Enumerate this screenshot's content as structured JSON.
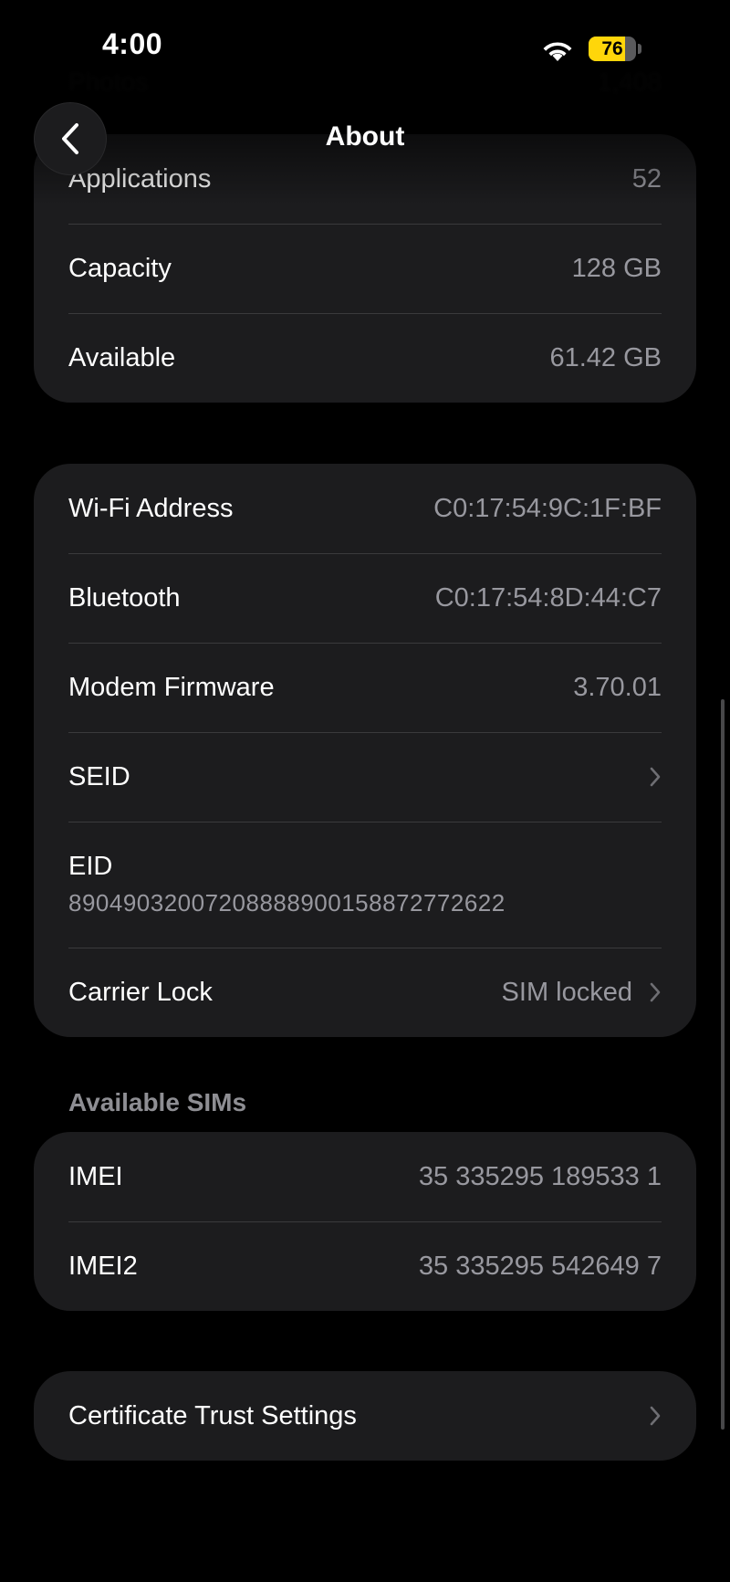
{
  "status_bar": {
    "time": "4:00",
    "battery_percent": "76",
    "battery_level": 0.76,
    "wifi_icon": "wifi-icon",
    "battery_color": "#ffd60a"
  },
  "ghost_rows": [
    {
      "label": "Photos",
      "value": "1,408"
    }
  ],
  "nav": {
    "title": "About",
    "back_icon": "chevron-left-icon"
  },
  "storage_group": [
    {
      "label": "Applications",
      "value": "52"
    },
    {
      "label": "Capacity",
      "value": "128 GB"
    },
    {
      "label": "Available",
      "value": "61.42 GB"
    }
  ],
  "network_group": {
    "wifi_address": {
      "label": "Wi-Fi Address",
      "value": "C0:17:54:9C:1F:BF"
    },
    "bluetooth": {
      "label": "Bluetooth",
      "value": "C0:17:54:8D:44:C7"
    },
    "modem_firmware": {
      "label": "Modem Firmware",
      "value": "3.70.01"
    },
    "seid": {
      "label": "SEID"
    },
    "eid": {
      "label": "EID",
      "value": "89049032007208888900158872772622"
    },
    "carrier_lock": {
      "label": "Carrier Lock",
      "value": "SIM locked"
    }
  },
  "sims_section": {
    "header": "Available SIMs",
    "imei": {
      "label": "IMEI",
      "value": "35 335295 189533 1"
    },
    "imei2": {
      "label": "IMEI2",
      "value": "35 335295 542649 7"
    }
  },
  "certificate": {
    "label": "Certificate Trust Settings"
  },
  "colors": {
    "background": "#000000",
    "group_background": "#1c1c1e",
    "secondary_text": "#98989f",
    "separator": "#3a3a3c"
  }
}
